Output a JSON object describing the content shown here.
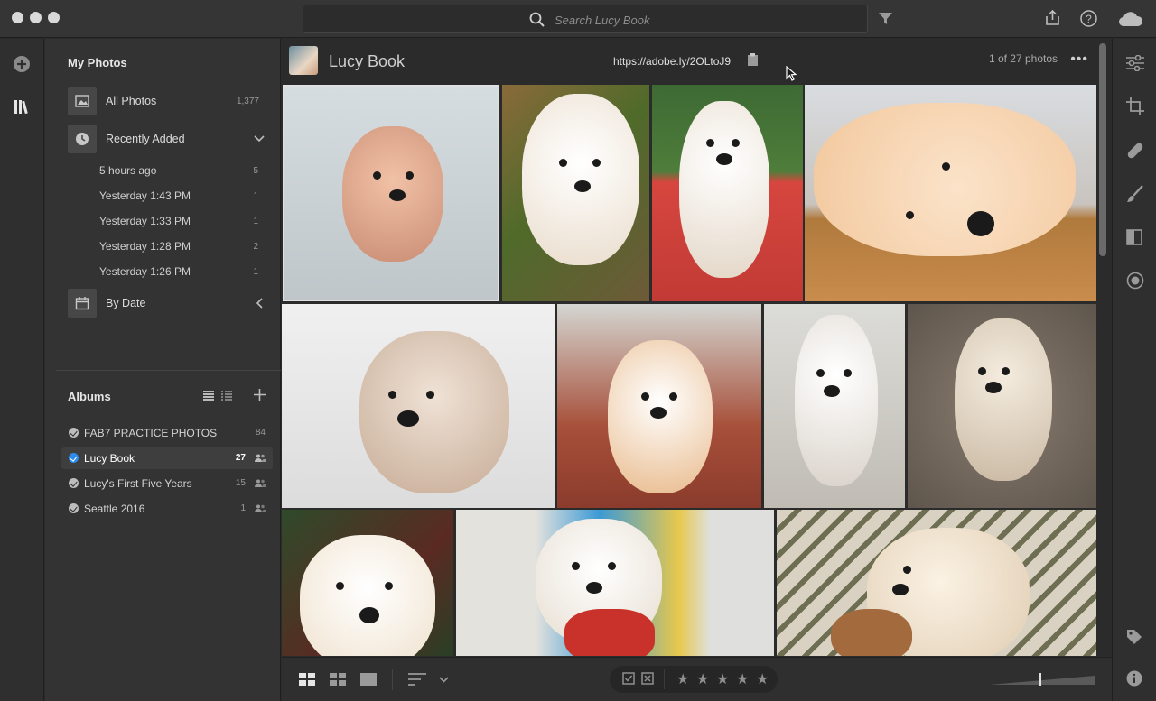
{
  "search": {
    "placeholder": "Search Lucy Book"
  },
  "sidebar": {
    "my_photos_title": "My Photos",
    "all_photos": {
      "label": "All Photos",
      "count": "1,377"
    },
    "recently_added": {
      "label": "Recently Added",
      "items": [
        {
          "label": "5 hours ago",
          "count": "5"
        },
        {
          "label": "Yesterday 1:43 PM",
          "count": "1"
        },
        {
          "label": "Yesterday 1:33 PM",
          "count": "1"
        },
        {
          "label": "Yesterday 1:28 PM",
          "count": "2"
        },
        {
          "label": "Yesterday 1:26 PM",
          "count": "1"
        }
      ]
    },
    "by_date": {
      "label": "By Date"
    },
    "albums_title": "Albums",
    "albums": [
      {
        "label": "FAB7 PRACTICE PHOTOS",
        "count": "84"
      },
      {
        "label": "Lucy Book",
        "count": "27"
      },
      {
        "label": "Lucy's First Five Years",
        "count": "15"
      },
      {
        "label": "Seattle 2016",
        "count": "1"
      }
    ]
  },
  "main": {
    "album_title": "Lucy Book",
    "share_url": "https://adobe.ly/2OLtoJ9",
    "photo_count": "1 of 27 photos",
    "more": "•••"
  },
  "colors": {
    "accent": "#2d8ceb",
    "background": "#2b2b2b",
    "panel": "#333333"
  },
  "icons": [
    "add-icon",
    "library-icon",
    "search-icon",
    "filter-icon",
    "share-icon",
    "help-icon",
    "cloud-icon",
    "edit-sliders-icon",
    "crop-icon",
    "healing-icon",
    "brush-icon",
    "gradient-icon",
    "radial-icon",
    "keyword-tag-icon",
    "info-icon"
  ]
}
